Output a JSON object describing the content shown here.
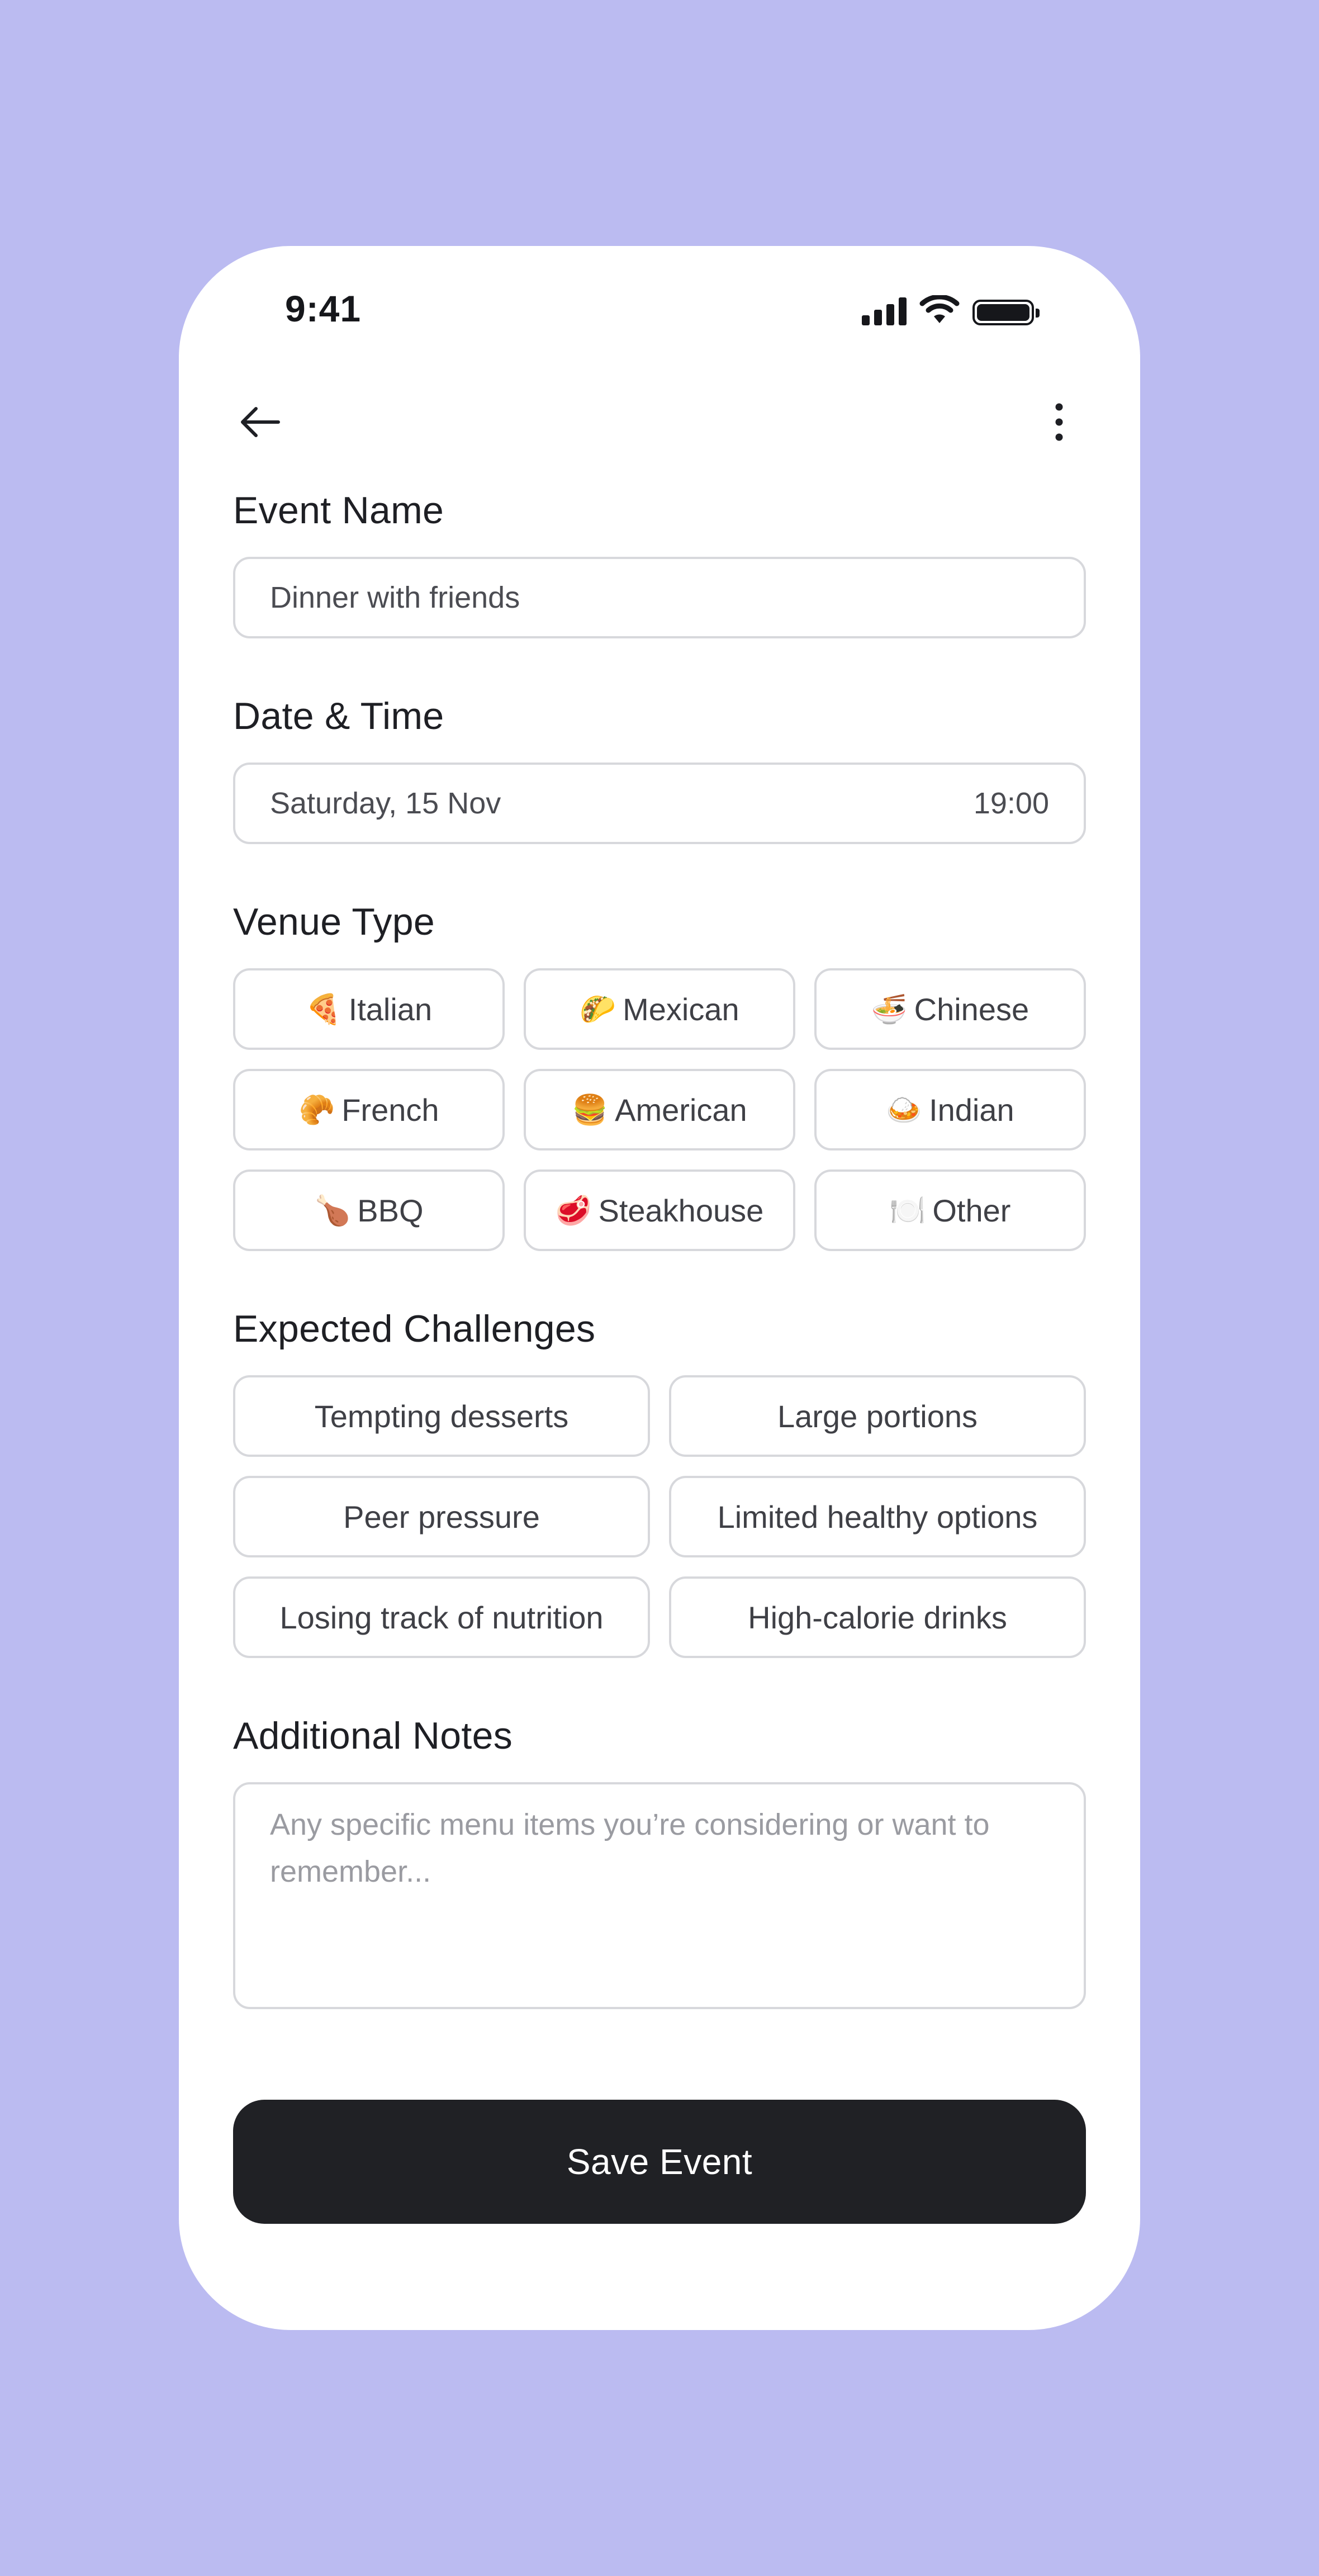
{
  "status_bar": {
    "time": "9:41"
  },
  "header": {
    "back_icon": "arrow-left-icon",
    "more_icon": "more-vertical-icon"
  },
  "event_name": {
    "label": "Event Name",
    "value": "Dinner with friends"
  },
  "date_time": {
    "label": "Date & Time",
    "date": "Saturday, 15 Nov",
    "time": "19:00"
  },
  "venue_type": {
    "label": "Venue Type",
    "options": [
      {
        "emoji": "🍕",
        "label": "Italian"
      },
      {
        "emoji": "🌮",
        "label": "Mexican"
      },
      {
        "emoji": "🍜",
        "label": "Chinese"
      },
      {
        "emoji": "🥐",
        "label": "French"
      },
      {
        "emoji": "🍔",
        "label": "American"
      },
      {
        "emoji": "🍛",
        "label": "Indian"
      },
      {
        "emoji": "🍗",
        "label": "BBQ"
      },
      {
        "emoji": "🥩",
        "label": "Steakhouse"
      },
      {
        "emoji": "🍽️",
        "label": "Other"
      }
    ]
  },
  "challenges": {
    "label": "Expected Challenges",
    "options": [
      "Tempting desserts",
      "Large portions",
      "Peer pressure",
      "Limited healthy options",
      "Losing track of nutrition",
      "High-calorie drinks"
    ]
  },
  "notes": {
    "label": "Additional Notes",
    "placeholder": "Any specific menu items you’re considering or want to remember..."
  },
  "save_button": {
    "label": "Save Event"
  },
  "colors": {
    "background": "#bbbbf1",
    "card": "#ffffff",
    "primary_button": "#202125",
    "border": "#d7d8dc"
  }
}
